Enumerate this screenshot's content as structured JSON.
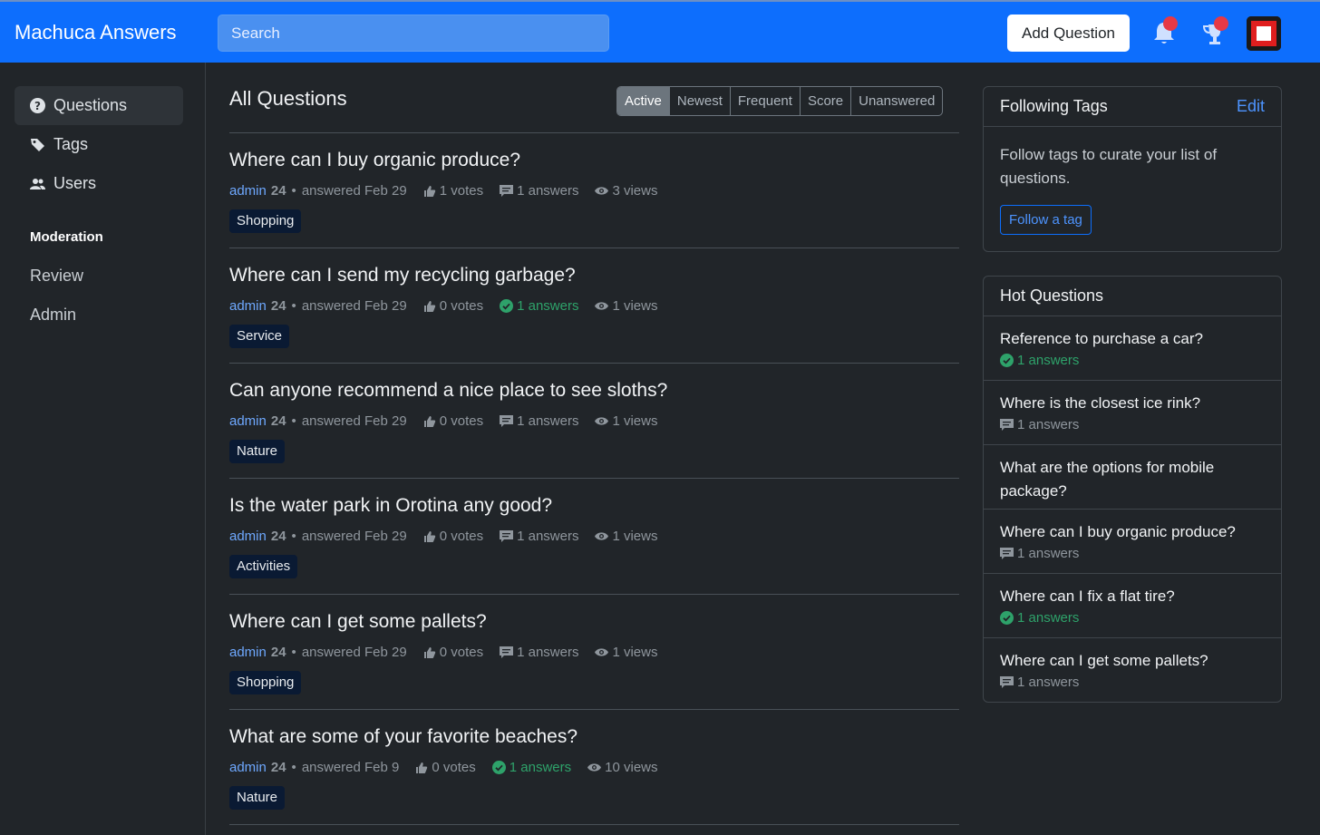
{
  "header": {
    "brand": "Machuca Answers",
    "search_placeholder": "Search",
    "add_question": "Add Question"
  },
  "sidebar": {
    "items": [
      {
        "label": "Questions",
        "icon": "question-circle-icon",
        "active": true
      },
      {
        "label": "Tags",
        "icon": "tags-icon"
      },
      {
        "label": "Users",
        "icon": "users-icon"
      }
    ],
    "moderation_heading": "Moderation",
    "moderation_items": [
      "Review",
      "Admin"
    ]
  },
  "main": {
    "title": "All Questions",
    "filters": [
      "Active",
      "Newest",
      "Frequent",
      "Score",
      "Unanswered"
    ],
    "active_filter": "Active",
    "questions": [
      {
        "title": "Where can I buy organic produce?",
        "user": "admin",
        "rep": "24",
        "when": "answered Feb 29",
        "votes": "1 votes",
        "answers": "1 answers",
        "accepted": false,
        "views": "3 views",
        "tag": "Shopping"
      },
      {
        "title": "Where can I send my recycling garbage?",
        "user": "admin",
        "rep": "24",
        "when": "answered Feb 29",
        "votes": "0 votes",
        "answers": "1 answers",
        "accepted": true,
        "views": "1 views",
        "tag": "Service"
      },
      {
        "title": "Can anyone recommend a nice place to see sloths?",
        "user": "admin",
        "rep": "24",
        "when": "answered Feb 29",
        "votes": "0 votes",
        "answers": "1 answers",
        "accepted": false,
        "views": "1 views",
        "tag": "Nature"
      },
      {
        "title": "Is the water park in Orotina any good?",
        "user": "admin",
        "rep": "24",
        "when": "answered Feb 29",
        "votes": "0 votes",
        "answers": "1 answers",
        "accepted": false,
        "views": "1 views",
        "tag": "Activities"
      },
      {
        "title": "Where can I get some pallets?",
        "user": "admin",
        "rep": "24",
        "when": "answered Feb 29",
        "votes": "0 votes",
        "answers": "1 answers",
        "accepted": false,
        "views": "1 views",
        "tag": "Shopping"
      },
      {
        "title": "What are some of your favorite beaches?",
        "user": "admin",
        "rep": "24",
        "when": "answered Feb 9",
        "votes": "0 votes",
        "answers": "1 answers",
        "accepted": true,
        "views": "10 views",
        "tag": "Nature"
      }
    ]
  },
  "following_tags": {
    "title": "Following Tags",
    "edit": "Edit",
    "body": "Follow tags to curate your list of questions.",
    "button": "Follow a tag"
  },
  "hot_questions": {
    "title": "Hot Questions",
    "items": [
      {
        "title": "Reference to purchase a car?",
        "answers": "1 answers",
        "accepted": true
      },
      {
        "title": "Where is the closest ice rink?",
        "answers": "1 answers",
        "accepted": false
      },
      {
        "title": "What are the options for mobile package?",
        "answers": "",
        "accepted": false
      },
      {
        "title": "Where can I buy organic produce?",
        "answers": "1 answers",
        "accepted": false
      },
      {
        "title": "Where can I fix a flat tire?",
        "answers": "1 answers",
        "accepted": true
      },
      {
        "title": "Where can I get some pallets?",
        "answers": "1 answers",
        "accepted": false
      }
    ]
  },
  "colors": {
    "header": "#0d6efd",
    "background": "#212529",
    "accepted": "#2ea26a",
    "link": "#6ea8fe"
  }
}
